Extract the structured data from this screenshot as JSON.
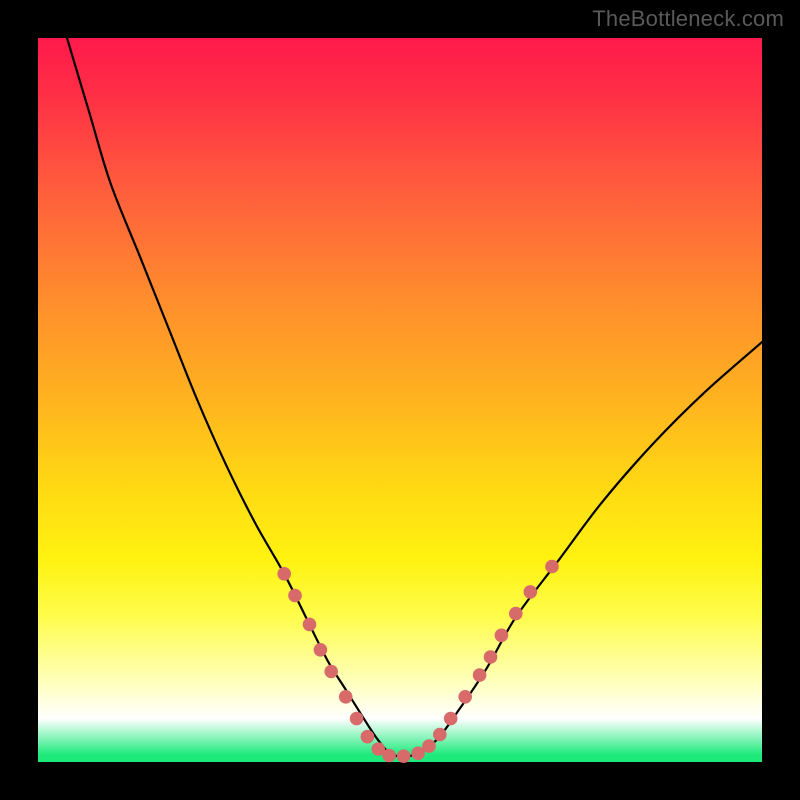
{
  "watermark": {
    "text": "TheBottleneck.com"
  },
  "chart_data": {
    "type": "line",
    "title": "",
    "xlabel": "",
    "ylabel": "",
    "xlim": [
      0,
      100
    ],
    "ylim": [
      0,
      100
    ],
    "grid": false,
    "legend": false,
    "gradient_stops": [
      {
        "pos": 0,
        "color": "#ff1a4b"
      },
      {
        "pos": 0.2,
        "color": "#ff5a3e"
      },
      {
        "pos": 0.5,
        "color": "#ffb31f"
      },
      {
        "pos": 0.72,
        "color": "#fff210"
      },
      {
        "pos": 0.94,
        "color": "#ffffff"
      },
      {
        "pos": 1.0,
        "color": "#1eea7c"
      }
    ],
    "series": [
      {
        "name": "bottleneck-curve",
        "x": [
          4,
          7,
          10,
          14,
          18,
          22,
          26,
          30,
          34,
          37,
          40,
          42.5,
          45,
          47,
          49,
          52,
          55,
          58,
          62,
          66,
          72,
          78,
          85,
          92,
          100
        ],
        "y": [
          100,
          90,
          80,
          70,
          60,
          50,
          41,
          33,
          26,
          20,
          14,
          10,
          6,
          3,
          1,
          1,
          3,
          7,
          13,
          20,
          28,
          36,
          44,
          51,
          58
        ]
      }
    ],
    "markers": [
      {
        "x": 34,
        "y": 26
      },
      {
        "x": 35.5,
        "y": 23
      },
      {
        "x": 37.5,
        "y": 19
      },
      {
        "x": 39,
        "y": 15.5
      },
      {
        "x": 40.5,
        "y": 12.5
      },
      {
        "x": 42.5,
        "y": 9
      },
      {
        "x": 44,
        "y": 6
      },
      {
        "x": 45.5,
        "y": 3.5
      },
      {
        "x": 47,
        "y": 1.8
      },
      {
        "x": 48.5,
        "y": 0.9
      },
      {
        "x": 50.5,
        "y": 0.8
      },
      {
        "x": 52.5,
        "y": 1.2
      },
      {
        "x": 54,
        "y": 2.2
      },
      {
        "x": 55.5,
        "y": 3.8
      },
      {
        "x": 57,
        "y": 6
      },
      {
        "x": 59,
        "y": 9
      },
      {
        "x": 61,
        "y": 12
      },
      {
        "x": 62.5,
        "y": 14.5
      },
      {
        "x": 64,
        "y": 17.5
      },
      {
        "x": 66,
        "y": 20.5
      },
      {
        "x": 68,
        "y": 23.5
      },
      {
        "x": 71,
        "y": 27
      }
    ],
    "marker_style": {
      "color": "#d86a6a",
      "radius": 6.8
    }
  }
}
